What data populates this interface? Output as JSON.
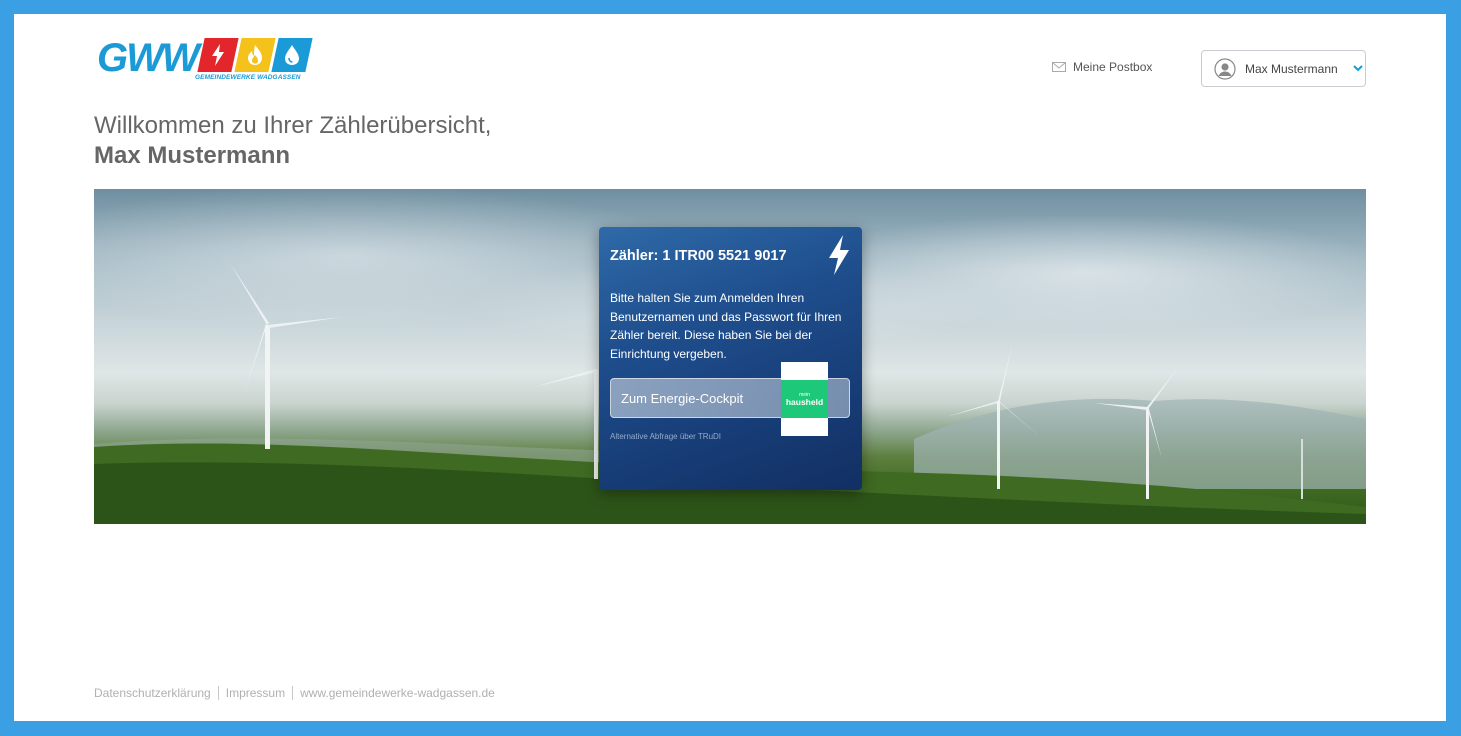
{
  "brand": {
    "logo_text": "GWW",
    "logo_subtitle": "GEMEINDEWERKE WADGASSEN",
    "colors": {
      "blue": "#1a9ad6",
      "red": "#e3262b",
      "yellow": "#f4c21a",
      "frame": "#3aa0e3"
    }
  },
  "header": {
    "postbox_label": "Meine Postbox",
    "postbox_icon": "envelope-icon",
    "user_name": "Max Mustermann",
    "user_icon": "user-avatar-icon",
    "user_dropdown_icon": "chevron-down-icon"
  },
  "welcome": {
    "line1": "Willkommen zu Ihrer Zählerübersicht,",
    "line2": "Max Mustermann"
  },
  "card": {
    "meter_title": "Zähler: 1 ITR00 5521 9017",
    "icon": "lightning-bolt-icon",
    "description": "Bitte halten Sie zum Anmelden Ihren Benutzernamen und das Passwort für Ihren Zähler bereit. Diese haben Sie bei der Einrichtung vergeben.",
    "cockpit_button": "Zum Energie-Cockpit",
    "badge_small": "mein",
    "badge_big": "hausheld",
    "badge_color": "#1dc978",
    "trudi_link": "Alternative Abfrage über TRuDI"
  },
  "footer": {
    "links": [
      "Datenschutzerklärung",
      "Impressum",
      "www.gemeindewerke-wadgassen.de"
    ]
  }
}
